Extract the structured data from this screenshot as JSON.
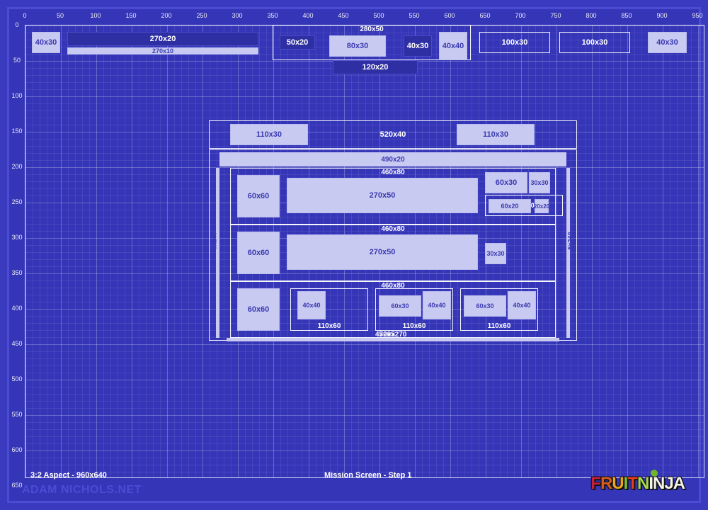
{
  "meta": {
    "aspect": "3:2 Aspect - 960x640",
    "title": "Mission Screen - Step 1",
    "brand_watermark": "ADAM NICHOLS.NET",
    "brand_logo": "FRUIT NINJA"
  },
  "ruler_x": [
    "0",
    "50",
    "100",
    "150",
    "200",
    "250",
    "300",
    "350",
    "400",
    "450",
    "500",
    "550",
    "600",
    "650",
    "700",
    "750",
    "800",
    "850",
    "900",
    "950"
  ],
  "ruler_y": [
    "0",
    "50",
    "100",
    "150",
    "200",
    "250",
    "300",
    "350",
    "400",
    "450",
    "500",
    "550",
    "600",
    "650"
  ],
  "boxes": {
    "top_bar_label": "280x50",
    "top_left_icon": "40x30",
    "top_long_top": "270x20",
    "top_long_bot": "270x10",
    "top_score": "50x20",
    "top_center": "80x30",
    "top_small": "40x30",
    "top_square": "40x40",
    "top_right1": "100x30",
    "top_right2": "100x30",
    "top_corner": "40x30",
    "below_center": "120x20",
    "main_header": "520x40",
    "tab_left": "110x30",
    "tab_right": "110x30",
    "row_title": "490x20",
    "row_bg": "460x80",
    "item_icon": "60x60",
    "item_text": "270x50",
    "badge_a": "60x30",
    "badge_b": "30x30",
    "badge_c": "110x30",
    "badge_d": "60x20",
    "badge_e": "20x20",
    "badge_mid": "30x30",
    "slot_box": "40x40",
    "slot_label": "110x60",
    "slot_badge": "60x30",
    "panel_bar": "470x5",
    "panel_size": "520x270",
    "side_rail": "5x240"
  }
}
